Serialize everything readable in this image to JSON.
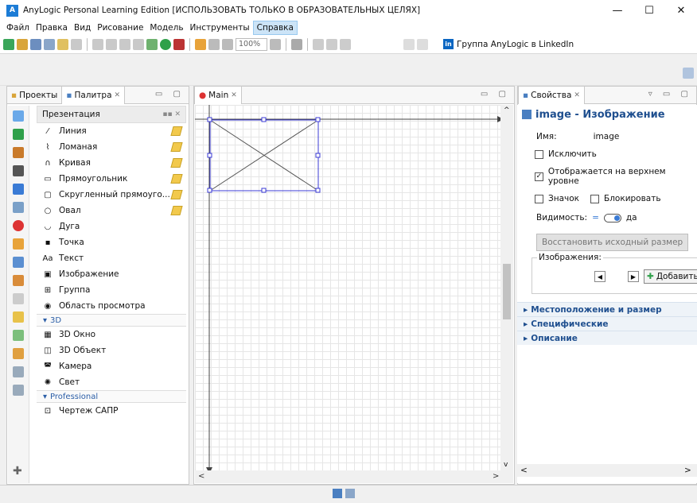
{
  "window": {
    "title": "AnyLogic Personal Learning Edition [ИСПОЛЬЗОВАТЬ ТОЛЬКО В ОБРАЗОВАТЕЛЬНЫХ ЦЕЛЯХ]",
    "logo": "A",
    "minimize": "—",
    "maximize": "☐",
    "close": "✕"
  },
  "menu": [
    "Файл",
    "Правка",
    "Вид",
    "Рисование",
    "Модель",
    "Инструменты",
    "Справка"
  ],
  "toolbar": {
    "zoom": "100%",
    "linkedin_badge": "in",
    "linkedin_label": "Группа AnyLogic в LinkedIn"
  },
  "left_tabs": {
    "projects": "Проекты",
    "palette": "Палитра",
    "close": "✕"
  },
  "palette": {
    "header": "Презентация",
    "items": [
      {
        "label": "Линия",
        "icon": "line-icon",
        "glyph": "⁄",
        "edit": true
      },
      {
        "label": "Ломаная",
        "icon": "polyline-icon",
        "glyph": "⌇",
        "edit": true
      },
      {
        "label": "Кривая",
        "icon": "curve-icon",
        "glyph": "∩",
        "edit": true
      },
      {
        "label": "Прямоугольник",
        "icon": "rectangle-icon",
        "glyph": "▭",
        "edit": true
      },
      {
        "label": "Скругленный прямоуго...",
        "icon": "rounded-rect-icon",
        "glyph": "▢",
        "edit": true
      },
      {
        "label": "Овал",
        "icon": "oval-icon",
        "glyph": "○",
        "edit": true
      },
      {
        "label": "Дуга",
        "icon": "arc-icon",
        "glyph": "◡",
        "edit": false
      },
      {
        "label": "Точка",
        "icon": "point-icon",
        "glyph": "▪",
        "edit": false
      },
      {
        "label": "Текст",
        "icon": "text-icon",
        "glyph": "Aa",
        "edit": false
      },
      {
        "label": "Изображение",
        "icon": "image-icon",
        "glyph": "▣",
        "edit": false
      },
      {
        "label": "Группа",
        "icon": "group-icon",
        "glyph": "⊞",
        "edit": false
      },
      {
        "label": "Область просмотра",
        "icon": "viewarea-icon",
        "glyph": "◉",
        "edit": false
      }
    ],
    "section_3d": "3D",
    "items_3d": [
      {
        "label": "3D Окно",
        "icon": "3d-window-icon",
        "glyph": "▦"
      },
      {
        "label": "3D Объект",
        "icon": "3d-object-icon",
        "glyph": "◫"
      },
      {
        "label": "Камера",
        "icon": "camera-icon",
        "glyph": "◚"
      },
      {
        "label": "Свет",
        "icon": "light-icon",
        "glyph": "✺"
      }
    ],
    "section_pro": "Professional",
    "items_pro": [
      {
        "label": "Чертеж САПР",
        "icon": "cad-icon",
        "glyph": "⊡"
      }
    ]
  },
  "editor": {
    "tab": "Main",
    "close": "✕",
    "scroll_left": "<",
    "scroll_right": ">",
    "scroll_up": "^",
    "scroll_down": "v"
  },
  "properties": {
    "tab": "Свойства",
    "close": "✕",
    "title": "image - Изображение",
    "name_label": "Имя:",
    "name_value": "image",
    "exclude": "Исключить",
    "top_level": "Отображается на верхнем уровне",
    "icon": "Значок",
    "lock": "Блокировать",
    "visibility_label": "Видимость:",
    "visibility_value": "да",
    "restore_button": "Восстановить исходный размер",
    "images_label": "Изображения:",
    "add_button": "Добавить",
    "prev": "◀",
    "next": "▶",
    "sections": [
      "Местоположение и размер",
      "Специфические",
      "Описание"
    ],
    "arrow": "▸",
    "checked": "✓"
  },
  "colors": {
    "accent": "#1f4f8f",
    "shape_blue": "#3b3bd6"
  }
}
